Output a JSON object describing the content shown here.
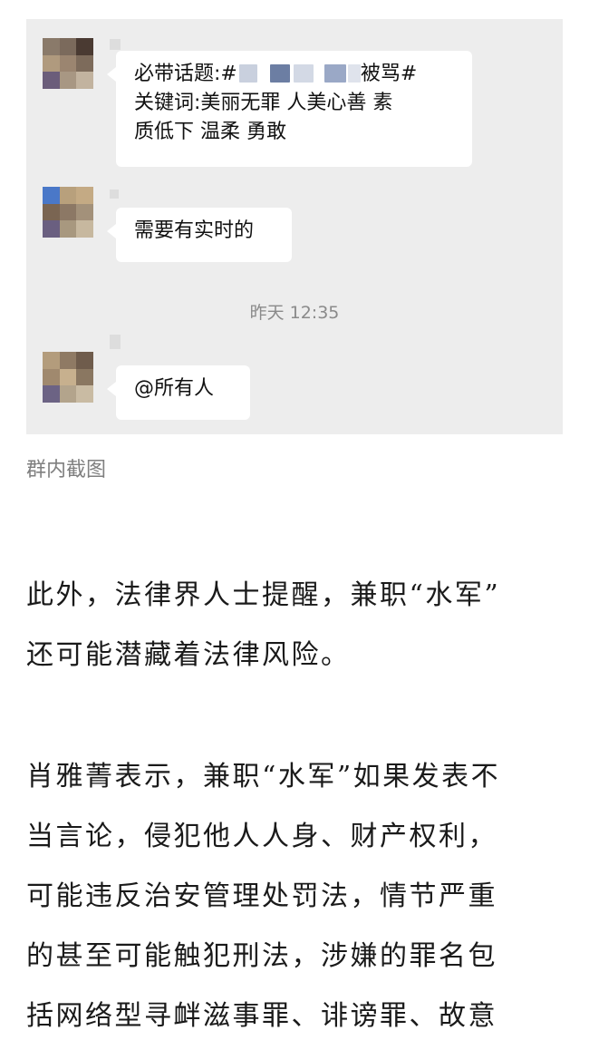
{
  "chat": {
    "messages": [
      {
        "lines": [
          "必带话题:#",
          "被骂#",
          "关键词:美丽无罪 人美心善 素",
          "质低下 温柔 勇敢"
        ]
      },
      {
        "lines": [
          "需要有实时的"
        ]
      },
      {
        "lines": [
          "@所有人"
        ]
      }
    ],
    "timestamp": "昨天 12:35"
  },
  "caption": "群内截图",
  "article": {
    "paragraph1": [
      "此外，法律界人士提醒，兼职“水军”",
      "还可能潜藏着法律风险。"
    ],
    "paragraph2": [
      "肖雅菁表示，兼职“水军”如果发表不",
      "当言论，侵犯他人人身、财产权利，",
      "可能违反治安管理处罚法，情节严重",
      "的甚至可能触犯刑法，涉嫌的罪名包",
      "括网络型寻衅滋事罪、诽谤罪、故意"
    ]
  },
  "colors": {
    "chat_background": "#ededed",
    "bubble": "#ffffff",
    "caption_text": "#7f7f7f",
    "body_text": "#1a1a1a"
  }
}
